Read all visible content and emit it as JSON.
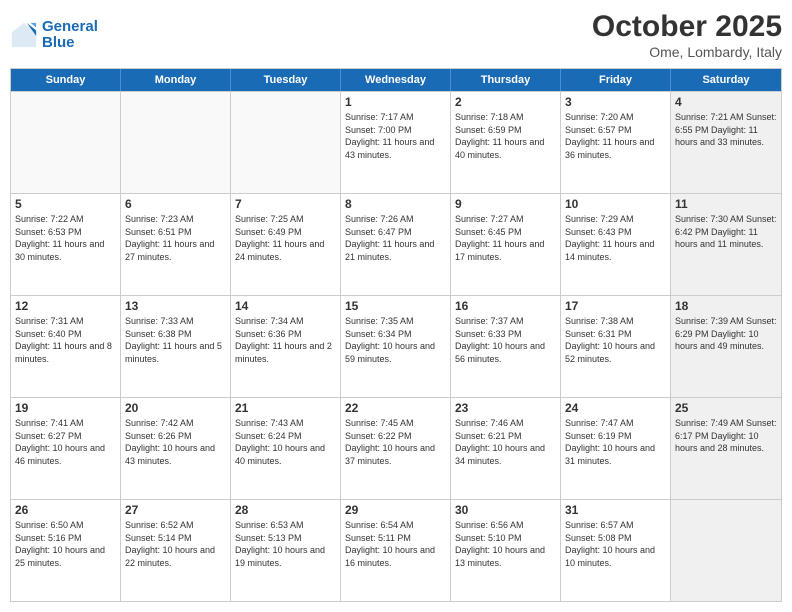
{
  "logo": {
    "line1": "General",
    "line2": "Blue"
  },
  "title": "October 2025",
  "subtitle": "Ome, Lombardy, Italy",
  "dayHeaders": [
    "Sunday",
    "Monday",
    "Tuesday",
    "Wednesday",
    "Thursday",
    "Friday",
    "Saturday"
  ],
  "weeks": [
    [
      {
        "day": "",
        "info": "",
        "empty": true
      },
      {
        "day": "",
        "info": "",
        "empty": true
      },
      {
        "day": "",
        "info": "",
        "empty": true
      },
      {
        "day": "1",
        "info": "Sunrise: 7:17 AM\nSunset: 7:00 PM\nDaylight: 11 hours and 43 minutes."
      },
      {
        "day": "2",
        "info": "Sunrise: 7:18 AM\nSunset: 6:59 PM\nDaylight: 11 hours and 40 minutes."
      },
      {
        "day": "3",
        "info": "Sunrise: 7:20 AM\nSunset: 6:57 PM\nDaylight: 11 hours and 36 minutes."
      },
      {
        "day": "4",
        "info": "Sunrise: 7:21 AM\nSunset: 6:55 PM\nDaylight: 11 hours and 33 minutes.",
        "shaded": true
      }
    ],
    [
      {
        "day": "5",
        "info": "Sunrise: 7:22 AM\nSunset: 6:53 PM\nDaylight: 11 hours and 30 minutes."
      },
      {
        "day": "6",
        "info": "Sunrise: 7:23 AM\nSunset: 6:51 PM\nDaylight: 11 hours and 27 minutes."
      },
      {
        "day": "7",
        "info": "Sunrise: 7:25 AM\nSunset: 6:49 PM\nDaylight: 11 hours and 24 minutes."
      },
      {
        "day": "8",
        "info": "Sunrise: 7:26 AM\nSunset: 6:47 PM\nDaylight: 11 hours and 21 minutes."
      },
      {
        "day": "9",
        "info": "Sunrise: 7:27 AM\nSunset: 6:45 PM\nDaylight: 11 hours and 17 minutes."
      },
      {
        "day": "10",
        "info": "Sunrise: 7:29 AM\nSunset: 6:43 PM\nDaylight: 11 hours and 14 minutes."
      },
      {
        "day": "11",
        "info": "Sunrise: 7:30 AM\nSunset: 6:42 PM\nDaylight: 11 hours and 11 minutes.",
        "shaded": true
      }
    ],
    [
      {
        "day": "12",
        "info": "Sunrise: 7:31 AM\nSunset: 6:40 PM\nDaylight: 11 hours and 8 minutes."
      },
      {
        "day": "13",
        "info": "Sunrise: 7:33 AM\nSunset: 6:38 PM\nDaylight: 11 hours and 5 minutes."
      },
      {
        "day": "14",
        "info": "Sunrise: 7:34 AM\nSunset: 6:36 PM\nDaylight: 11 hours and 2 minutes."
      },
      {
        "day": "15",
        "info": "Sunrise: 7:35 AM\nSunset: 6:34 PM\nDaylight: 10 hours and 59 minutes."
      },
      {
        "day": "16",
        "info": "Sunrise: 7:37 AM\nSunset: 6:33 PM\nDaylight: 10 hours and 56 minutes."
      },
      {
        "day": "17",
        "info": "Sunrise: 7:38 AM\nSunset: 6:31 PM\nDaylight: 10 hours and 52 minutes."
      },
      {
        "day": "18",
        "info": "Sunrise: 7:39 AM\nSunset: 6:29 PM\nDaylight: 10 hours and 49 minutes.",
        "shaded": true
      }
    ],
    [
      {
        "day": "19",
        "info": "Sunrise: 7:41 AM\nSunset: 6:27 PM\nDaylight: 10 hours and 46 minutes."
      },
      {
        "day": "20",
        "info": "Sunrise: 7:42 AM\nSunset: 6:26 PM\nDaylight: 10 hours and 43 minutes."
      },
      {
        "day": "21",
        "info": "Sunrise: 7:43 AM\nSunset: 6:24 PM\nDaylight: 10 hours and 40 minutes."
      },
      {
        "day": "22",
        "info": "Sunrise: 7:45 AM\nSunset: 6:22 PM\nDaylight: 10 hours and 37 minutes."
      },
      {
        "day": "23",
        "info": "Sunrise: 7:46 AM\nSunset: 6:21 PM\nDaylight: 10 hours and 34 minutes."
      },
      {
        "day": "24",
        "info": "Sunrise: 7:47 AM\nSunset: 6:19 PM\nDaylight: 10 hours and 31 minutes."
      },
      {
        "day": "25",
        "info": "Sunrise: 7:49 AM\nSunset: 6:17 PM\nDaylight: 10 hours and 28 minutes.",
        "shaded": true
      }
    ],
    [
      {
        "day": "26",
        "info": "Sunrise: 6:50 AM\nSunset: 5:16 PM\nDaylight: 10 hours and 25 minutes."
      },
      {
        "day": "27",
        "info": "Sunrise: 6:52 AM\nSunset: 5:14 PM\nDaylight: 10 hours and 22 minutes."
      },
      {
        "day": "28",
        "info": "Sunrise: 6:53 AM\nSunset: 5:13 PM\nDaylight: 10 hours and 19 minutes."
      },
      {
        "day": "29",
        "info": "Sunrise: 6:54 AM\nSunset: 5:11 PM\nDaylight: 10 hours and 16 minutes."
      },
      {
        "day": "30",
        "info": "Sunrise: 6:56 AM\nSunset: 5:10 PM\nDaylight: 10 hours and 13 minutes."
      },
      {
        "day": "31",
        "info": "Sunrise: 6:57 AM\nSunset: 5:08 PM\nDaylight: 10 hours and 10 minutes."
      },
      {
        "day": "",
        "info": "",
        "empty": true,
        "shaded": true
      }
    ]
  ]
}
